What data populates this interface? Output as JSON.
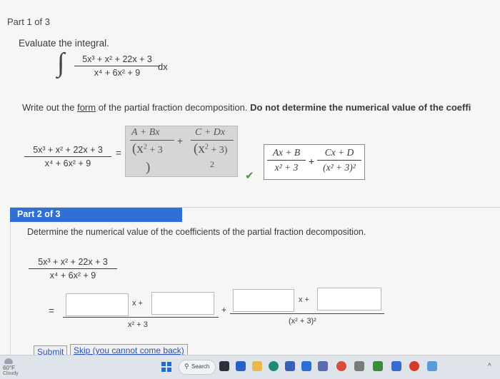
{
  "part1": {
    "label": "Part 1 of 3",
    "instruction": "Evaluate the integral.",
    "integral_sign": "∫",
    "integrand_num": "5x³ + x² + 22x + 3",
    "integrand_den": "x⁴ + 6x² + 9",
    "dx": "dx",
    "write_prefix": "Write out the ",
    "write_link": "form",
    "write_middle": " of the partial fraction decomposition. ",
    "write_bold": "Do not determine the numerical value of the coeffi",
    "lhs_num": "5x³ + x² + 22x + 3",
    "lhs_den": "x⁴ + 6x² + 9",
    "equals": "=",
    "gray_t1_num": "A + Bx",
    "gray_t1_den_a": "(x",
    "gray_t1_den_sup": "2",
    "gray_t1_den_b": " + 3",
    "gray_t1_close": ")",
    "gray_plus": "+",
    "gray_t2_num": "C + Dx",
    "gray_t2_den_a": "(x",
    "gray_t2_den_sup": "2",
    "gray_t2_den_b": " + 3)",
    "gray_t2_exp": "2",
    "check": "✔",
    "ans_t1_num": "Ax + B",
    "ans_t1_den": "x² + 3",
    "ans_plus": "+",
    "ans_t2_num": "Cx + D",
    "ans_t2_den": "(x² + 3)²"
  },
  "part2": {
    "label": "Part 2 of 3",
    "instruction": "Determine the numerical value of the coefficients of the partial fraction decomposition.",
    "lhs_num": "5x³ + x² + 22x + 3",
    "lhs_den": "x⁴ + 6x² + 9",
    "equals": "=",
    "x_plus_1": "x +",
    "x_plus_2": "x +",
    "plus": "+",
    "den1": "x² + 3",
    "den2": "(x² + 3)²",
    "submit": "Submit",
    "skip": "Skip (you cannot come back)"
  },
  "taskbar": {
    "weather_temp": "60°F",
    "weather_desc": "Cloudy",
    "search": "Search"
  },
  "colors": {
    "blue_bar": "#2f6fd6",
    "check_green": "#3c9a3c"
  }
}
